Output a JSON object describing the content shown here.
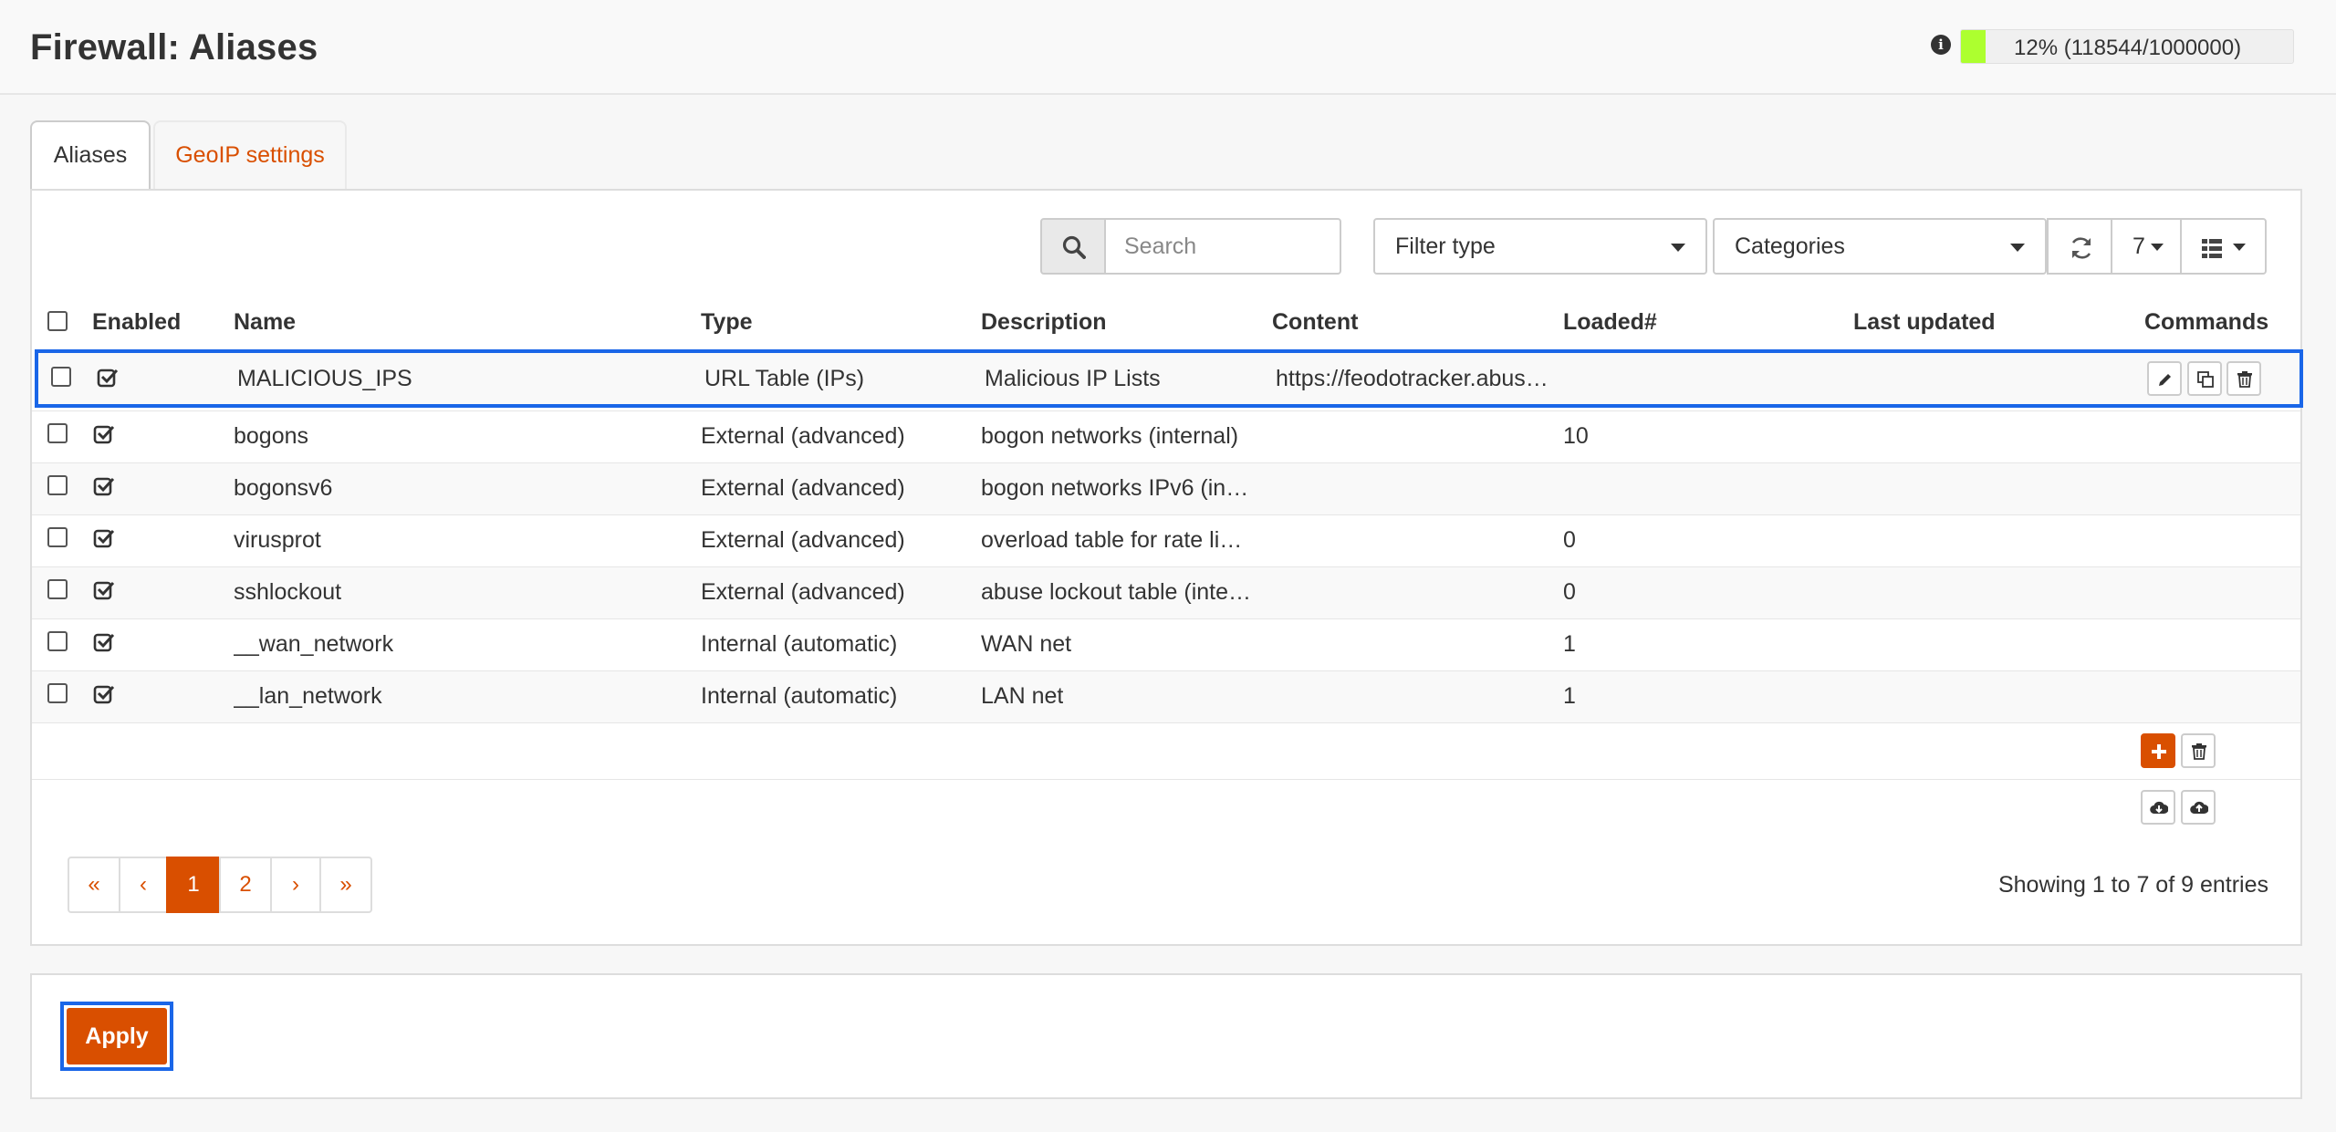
{
  "header": {
    "title": "Firewall: Aliases",
    "usage_text": "12% (118544/1000000)",
    "usage_fraction": 0.12,
    "usage_color": "#adff2f"
  },
  "tabs": [
    {
      "label": "Aliases",
      "active": true
    },
    {
      "label": "GeoIP settings",
      "active": false
    }
  ],
  "toolbar": {
    "search_placeholder": "Search",
    "filter_type": "Filter type",
    "categories": "Categories",
    "page_size": "7"
  },
  "table": {
    "headers": {
      "enabled": "Enabled",
      "name": "Name",
      "type": "Type",
      "description": "Description",
      "content": "Content",
      "loaded": "Loaded#",
      "last_updated": "Last updated",
      "commands": "Commands"
    },
    "rows": [
      {
        "name": "MALICIOUS_IPS",
        "type": "URL Table (IPs)",
        "description": "Malicious IP Lists",
        "content": "https://feodotracker.abus…",
        "loaded": "",
        "last_updated": ""
      },
      {
        "name": "bogons",
        "type": "External (advanced)",
        "description": "bogon networks (internal)",
        "content": "",
        "loaded": "10",
        "last_updated": ""
      },
      {
        "name": "bogonsv6",
        "type": "External (advanced)",
        "description": "bogon networks IPv6 (int…",
        "content": "",
        "loaded": "",
        "last_updated": ""
      },
      {
        "name": "virusprot",
        "type": "External (advanced)",
        "description": "overload table for rate lim…",
        "content": "",
        "loaded": "0",
        "last_updated": ""
      },
      {
        "name": "sshlockout",
        "type": "External (advanced)",
        "description": "abuse lockout table (inter…",
        "content": "",
        "loaded": "0",
        "last_updated": ""
      },
      {
        "name": "__wan_network",
        "type": "Internal (automatic)",
        "description": "WAN net",
        "content": "",
        "loaded": "1",
        "last_updated": ""
      },
      {
        "name": "__lan_network",
        "type": "Internal (automatic)",
        "description": "LAN net",
        "content": "",
        "loaded": "1",
        "last_updated": ""
      }
    ]
  },
  "pagination": {
    "first": "«",
    "prev": "‹",
    "pages": [
      "1",
      "2"
    ],
    "next": "›",
    "last": "»",
    "info": "Showing 1 to 7 of 9 entries"
  },
  "footer": {
    "apply_label": "Apply"
  },
  "colors": {
    "accent": "#d94f00",
    "selection": "#1a66e8"
  }
}
